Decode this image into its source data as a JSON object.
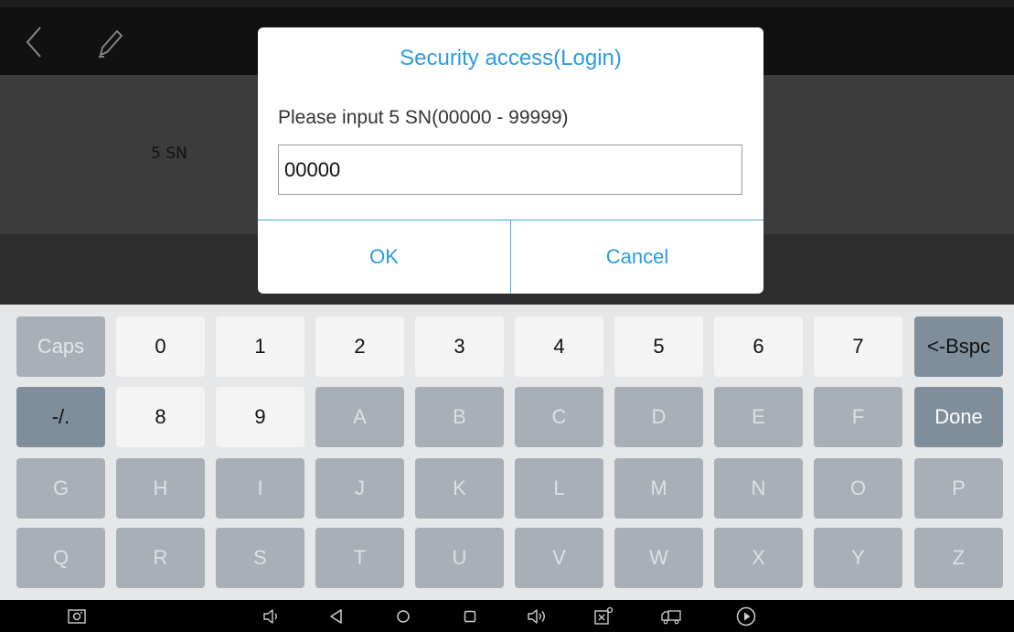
{
  "background": {
    "row_label": "5 SN",
    "icons": {
      "back": "chevron-left-icon",
      "edit": "pencil-icon"
    }
  },
  "dialog": {
    "title": "Security access(Login)",
    "message": "Please input 5 SN(00000 - 99999)",
    "input_value": "00000",
    "ok_label": "OK",
    "cancel_label": "Cancel"
  },
  "keyboard": {
    "rows": [
      [
        "Caps",
        "0",
        "1",
        "2",
        "3",
        "4",
        "5",
        "6",
        "7",
        "<-Bspc"
      ],
      [
        "-/.",
        "8",
        "9",
        "A",
        "B",
        "C",
        "D",
        "E",
        "F",
        "Done"
      ],
      [
        "G",
        "H",
        "I",
        "J",
        "K",
        "L",
        "M",
        "N",
        "O",
        "P"
      ],
      [
        "Q",
        "R",
        "S",
        "T",
        "U",
        "V",
        "W",
        "X",
        "Y",
        "Z"
      ]
    ]
  },
  "navbar": {
    "icons": [
      "screenshot-icon",
      "volume-down-icon",
      "back-triangle-icon",
      "home-circle-icon",
      "recents-square-icon",
      "volume-up-icon",
      "vci-icon",
      "truck-icon",
      "play-circle-icon"
    ]
  },
  "colors": {
    "accent": "#2a9de0",
    "key_light": "#f4f4f5",
    "key_disabled": "#a9afb7",
    "key_action": "#7f8e9b"
  }
}
